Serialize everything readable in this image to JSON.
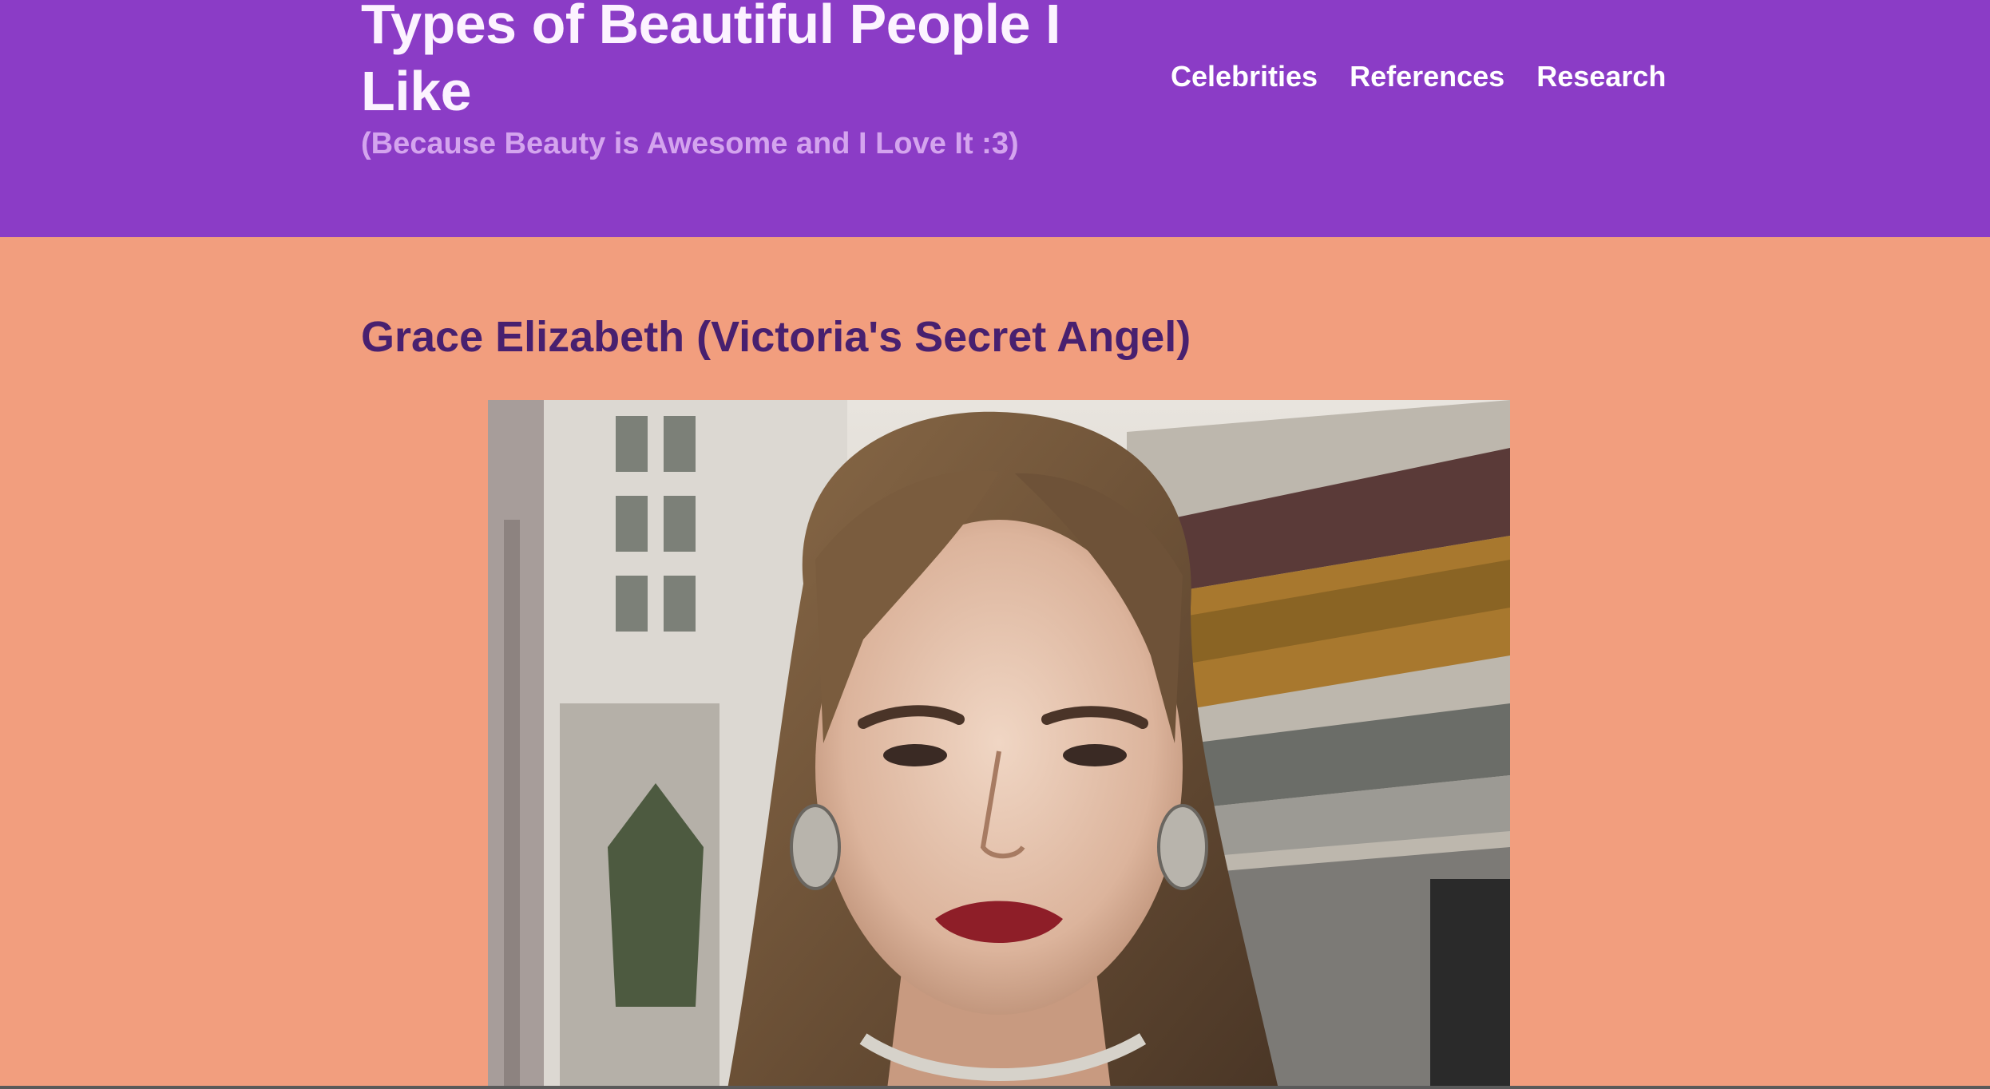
{
  "header": {
    "title": "Types of Beautiful People I Like",
    "subtitle": "(Because Beauty is Awesome and I Love It :3)",
    "nav": [
      {
        "label": "Celebrities"
      },
      {
        "label": "References"
      },
      {
        "label": "Research"
      }
    ]
  },
  "main": {
    "heading": "Grace Elizabeth (Victoria's Secret Angel)",
    "photo": {
      "icon": "portrait-photo"
    }
  },
  "colors": {
    "header_bg": "#8b3cc6",
    "page_bg": "#f29e7e",
    "title_text": "#fcf3ff",
    "subtitle_text": "#d4a4ee",
    "heading_text": "#48206f"
  }
}
